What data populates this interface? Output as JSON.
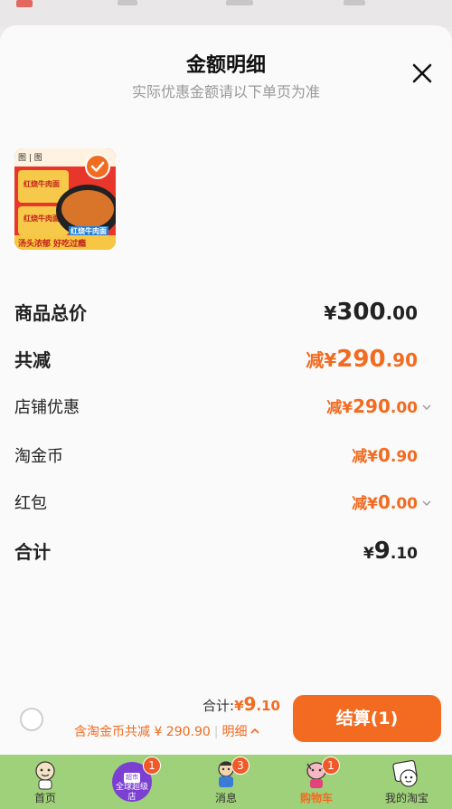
{
  "sheet": {
    "title": "金额明细",
    "subtitle": "实际优惠金额请以下单页为准"
  },
  "product": {
    "top_label": "图 | 图",
    "pack_label_1": "红烧牛肉面",
    "pack_label_2": "红烧牛肉面",
    "bowl_label": "红烧牛肉面",
    "banner": "汤头浓郁  好吃过瘾",
    "selected": true
  },
  "rows": {
    "total_price": {
      "label": "商品总价",
      "sym": "¥",
      "int": "300",
      "dec": ".00"
    },
    "total_reduce": {
      "label": "共减",
      "prefix": "减",
      "sym": "¥",
      "int": "290",
      "dec": ".90"
    },
    "shop_discount": {
      "label": "店铺优惠",
      "prefix": "减",
      "sym": "¥",
      "int": "290",
      "dec": ".00"
    },
    "taojinbi": {
      "label": "淘金币",
      "prefix": "减",
      "sym": "¥",
      "int": "0",
      "dec": ".90"
    },
    "hongbao": {
      "label": "红包",
      "prefix": "减",
      "sym": "¥",
      "int": "0",
      "dec": ".00"
    },
    "sum": {
      "label": "合计",
      "sym": "¥",
      "int": "9",
      "dec": ".10"
    }
  },
  "footer": {
    "total_label": "合计:",
    "total_sym": "¥",
    "total_int": "9",
    "total_dec": ".10",
    "saving_text": "含淘金币共减 ¥ 290.90",
    "detail_label": "明细",
    "checkout_label": "结算(1)"
  },
  "tabs": [
    {
      "label": "首页",
      "badge": ""
    },
    {
      "label": "全球超级店",
      "sub": "超市",
      "badge": "1"
    },
    {
      "label": "消息",
      "badge": "3"
    },
    {
      "label": "购物车",
      "badge": "1",
      "active": true
    },
    {
      "label": "我的淘宝",
      "badge": ""
    }
  ],
  "colors": {
    "accent": "#f26b21",
    "tabbar_bg": "#9fd07a",
    "mall_purple": "#7b3fd1"
  }
}
